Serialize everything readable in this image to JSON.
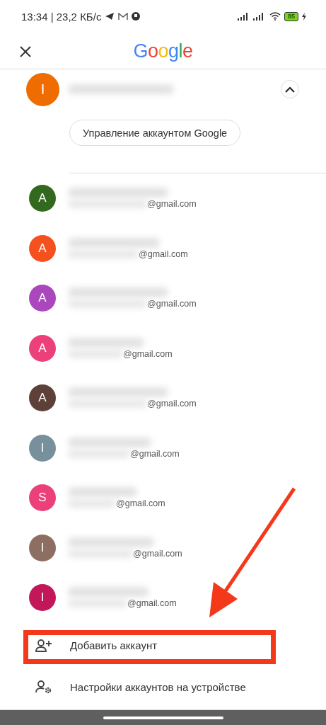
{
  "status_bar": {
    "time": "13:34 | 23,2 КБ/с",
    "battery": "85"
  },
  "header": {
    "logo": "Google"
  },
  "current_account": {
    "initial": "I",
    "color": "#ef6c00",
    "expanded": true,
    "manage_button": "Управление аккаунтом Google"
  },
  "accounts": [
    {
      "initial": "A",
      "color": "#33691e",
      "email": "@gmail.com"
    },
    {
      "initial": "A",
      "color": "#f4511e",
      "email": "@gmail.com"
    },
    {
      "initial": "A",
      "color": "#ab47bc",
      "email": "@gmail.com"
    },
    {
      "initial": "A",
      "color": "#ec407a",
      "email": "@gmail.com"
    },
    {
      "initial": "A",
      "color": "#5d4037",
      "email": "@gmail.com"
    },
    {
      "initial": "I",
      "color": "#78909c",
      "email": "@gmail.com"
    },
    {
      "initial": "S",
      "color": "#ec407a",
      "email": "@gmail.com"
    },
    {
      "initial": "I",
      "color": "#8d6e63",
      "email": "@gmail.com"
    },
    {
      "initial": "I",
      "color": "#c2185b",
      "email": "@gmail.com"
    }
  ],
  "actions": [
    {
      "kind": "add",
      "label": "Добавить аккаунт",
      "highlighted": true
    },
    {
      "kind": "settings",
      "label": "Настройки аккаунтов на устройстве",
      "highlighted": false
    }
  ]
}
